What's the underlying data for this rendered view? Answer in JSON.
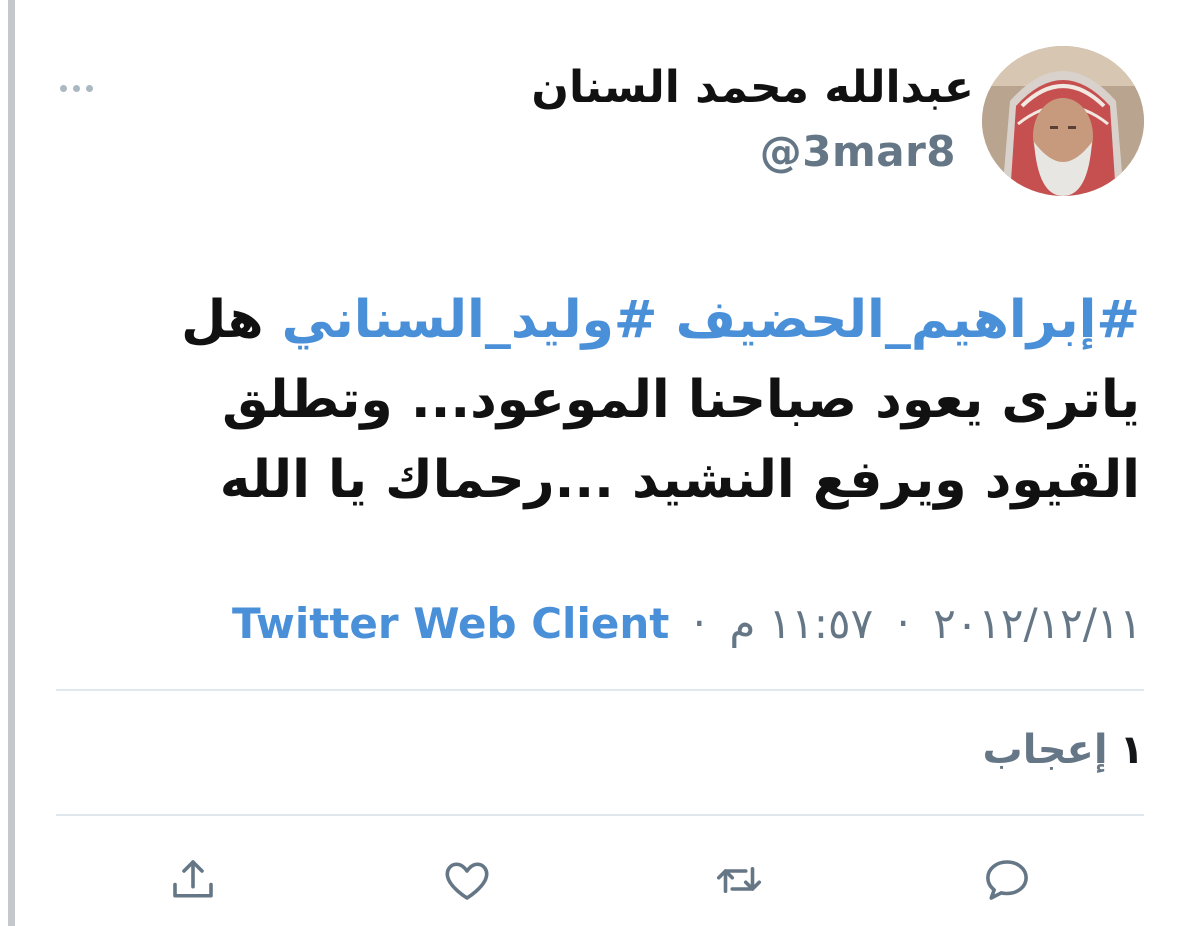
{
  "tweet": {
    "author": {
      "display_name": "عبدالله محمد السنان",
      "handle": "@3mar8"
    },
    "text": {
      "hashtag_1": "#إبراهيم_الحضيف",
      "hashtag_2": "#وليد_السناني",
      "body": "هل ياترى يعود صباحنا الموعود... وتطلق القيود ويرفع النشيد ...رحماك يا الله"
    },
    "meta": {
      "date": "٢٠١٢/١٢/١١",
      "time": "١١:٥٧ م",
      "separator": "·",
      "source": "Twitter Web Client"
    },
    "stats": {
      "like_count": "١",
      "like_label": "إعجاب"
    }
  },
  "actions": {
    "reply_icon": "reply-icon",
    "retweet_icon": "retweet-icon",
    "like_icon": "heart-icon",
    "share_icon": "share-icon"
  },
  "colors": {
    "accent": "#4a90d9",
    "muted": "#657786",
    "divider": "#e1e8ed"
  }
}
